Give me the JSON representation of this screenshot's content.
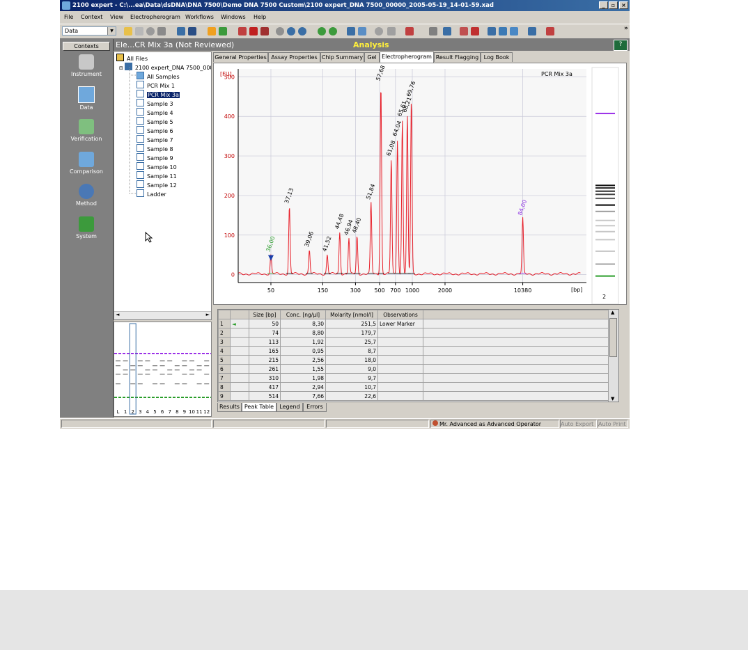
{
  "window": {
    "title": "2100 expert - C:\\...ea\\Data\\dsDNA\\DNA 7500\\Demo DNA 7500 Custom\\2100 expert_DNA 7500_00000_2005-05-19_14-01-59.xad",
    "controls": [
      "_",
      "▫",
      "×"
    ]
  },
  "menu": [
    "File",
    "Context",
    "View",
    "Electropherogram",
    "Workflows",
    "Windows",
    "Help"
  ],
  "toolbar": {
    "context_value": "Data",
    "overflow": "»"
  },
  "contexts": {
    "header": "Contexts",
    "items": [
      {
        "label": "Instrument",
        "icon": "instrument-icon",
        "color": "#c8c8c8"
      },
      {
        "label": "Data",
        "icon": "data-icon",
        "color": "#6fa8dc"
      },
      {
        "label": "Verification",
        "icon": "verification-icon",
        "color": "#7fbf7f"
      },
      {
        "label": "Comparison",
        "icon": "comparison-icon",
        "color": "#6fa8dc"
      },
      {
        "label": "Method",
        "icon": "method-icon",
        "color": "#4a78b5"
      },
      {
        "label": "System",
        "icon": "system-icon",
        "color": "#3c9a3c"
      }
    ]
  },
  "header": {
    "title": "Ele...CR Mix 3a (Not Reviewed)",
    "mode": "Analysis",
    "help": "?"
  },
  "tree": {
    "root": "All Files",
    "file": "2100 expert_DNA 7500_000",
    "all_samples": "All Samples",
    "samples": [
      "PCR Mix 1",
      "PCR Mix 3a",
      "Sample 3",
      "Sample 4",
      "Sample 5",
      "Sample 6",
      "Sample 7",
      "Sample 8",
      "Sample 9",
      "Sample 10",
      "Sample 11",
      "Sample 12",
      "Ladder"
    ],
    "selected": "PCR Mix 3a"
  },
  "gel_thumb": {
    "lanes": [
      "L",
      "1",
      "2",
      "3",
      "4",
      "5",
      "6",
      "7",
      "8",
      "9",
      "10",
      "11",
      "12"
    ]
  },
  "tabs": [
    "General Properties",
    "Assay Properties",
    "Chip Summary",
    "Gel",
    "Electropherogram",
    "Result Flagging",
    "Log Book"
  ],
  "active_tab": "Electropherogram",
  "chart_data": {
    "type": "line",
    "title": "PCR Mix 3a",
    "ylabel": "[FU]",
    "xlabel": "[bp]",
    "ylim": [
      -20,
      520
    ],
    "y_ticks": [
      0,
      100,
      200,
      300,
      400,
      500
    ],
    "x_tick_labels": [
      "50",
      "150",
      "300",
      "500",
      "700",
      "1000",
      "2000",
      "10380"
    ],
    "x_scale": "log",
    "grid": true,
    "series_color": "#e8202a",
    "peaks": [
      {
        "label": "36,00",
        "bp": 50,
        "fu": 48,
        "color": "#2a9d2a",
        "marker": true
      },
      {
        "label": "37,13",
        "bp": 74,
        "fu": 170,
        "color": "#000000"
      },
      {
        "label": "39,06",
        "bp": 113,
        "fu": 60,
        "color": "#000000"
      },
      {
        "label": "41,52",
        "bp": 165,
        "fu": 48,
        "color": "#000000"
      },
      {
        "label": "44,48",
        "bp": 215,
        "fu": 105,
        "color": "#000000"
      },
      {
        "label": "46,94",
        "bp": 261,
        "fu": 90,
        "color": "#000000"
      },
      {
        "label": "48,40",
        "bp": 310,
        "fu": 95,
        "color": "#000000"
      },
      {
        "label": "51,84",
        "bp": 417,
        "fu": 180,
        "color": "#000000"
      },
      {
        "label": "57,68",
        "bp": 514,
        "fu": 480,
        "color": "#000000"
      },
      {
        "label": "61,08",
        "bp": 640,
        "fu": 290,
        "color": "#000000"
      },
      {
        "label": "64,04",
        "bp": 730,
        "fu": 340,
        "color": "#000000"
      },
      {
        "label": "65,61",
        "bp": 810,
        "fu": 390,
        "color": "#000000"
      },
      {
        "label": "68,21",
        "bp": 900,
        "fu": 400,
        "color": "#000000"
      },
      {
        "label": "69,76",
        "bp": 980,
        "fu": 440,
        "color": "#000000"
      },
      {
        "label": "84,00",
        "bp": 10380,
        "fu": 140,
        "color": "#8a2be2"
      }
    ]
  },
  "gel_lane": {
    "lane_number": "2"
  },
  "peak_table": {
    "columns": [
      "Size [bp]",
      "Conc. [ng/µl]",
      "Molarity [nmol/l]",
      "Observations"
    ],
    "rows": [
      [
        "1",
        "50",
        "8,30",
        "251,5",
        "Lower Marker"
      ],
      [
        "2",
        "74",
        "8,80",
        "179,7",
        ""
      ],
      [
        "3",
        "113",
        "1,92",
        "25,7",
        ""
      ],
      [
        "4",
        "165",
        "0,95",
        "8,7",
        ""
      ],
      [
        "5",
        "215",
        "2,56",
        "18,0",
        ""
      ],
      [
        "6",
        "261",
        "1,55",
        "9,0",
        ""
      ],
      [
        "7",
        "310",
        "1,98",
        "9,7",
        ""
      ],
      [
        "8",
        "417",
        "2,94",
        "10,7",
        ""
      ],
      [
        "9",
        "514",
        "7,66",
        "22,6",
        ""
      ]
    ]
  },
  "bottom_tabs": [
    "Results",
    "Peak Table",
    "Legend",
    "Errors"
  ],
  "active_bottom_tab": "Peak Table",
  "status": {
    "user": "Mr. Advanced as Advanced Operator",
    "auto_export": "Auto Export",
    "auto_print": "Auto Print"
  }
}
